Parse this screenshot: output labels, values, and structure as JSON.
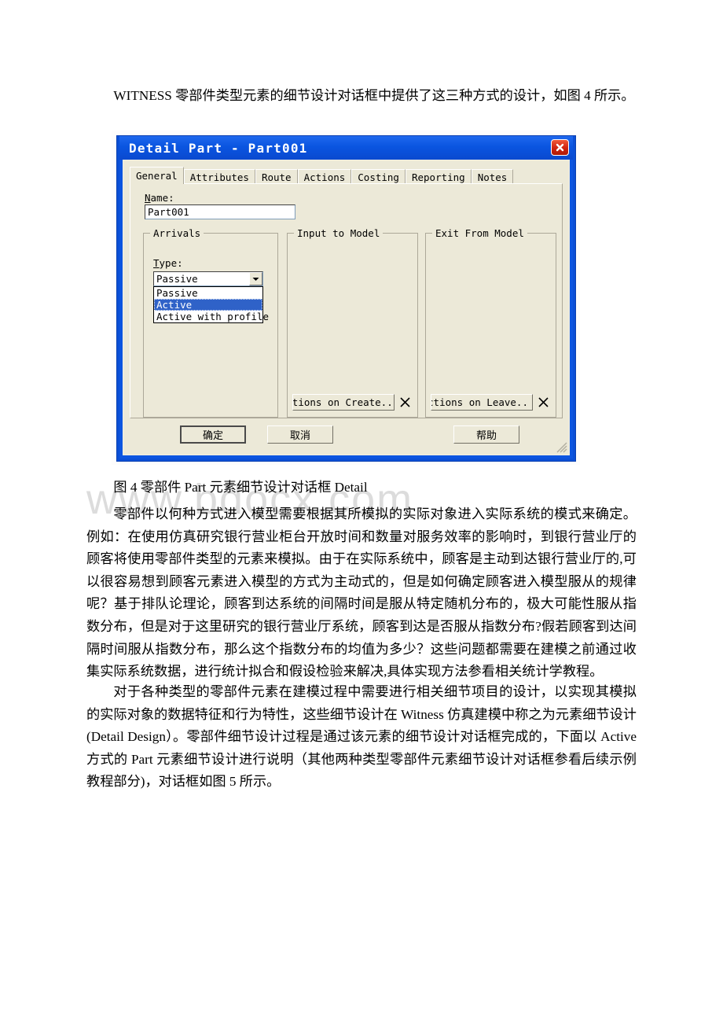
{
  "document": {
    "paragraph_1": "WITNESS 零部件类型元素的细节设计对话框中提供了这三种方式的设计，如图 4 所示。",
    "figure_caption": "图 4 零部件 Part 元素细节设计对话框 Detail",
    "paragraph_2": "零部件以何种方式进入模型需要根据其所模拟的实际对象进入实际系统的模式来确定。例如：在使用仿真研究银行营业柜台开放时间和数量对服务效率的影响时，到银行营业厅的顾客将使用零部件类型的元素来模拟。由于在实际系统中，顾客是主动到达银行营业厅的,可以很容易想到顾客元素进入模型的方式为主动式的，但是如何确定顾客进入模型服从的规律呢？基于排队论理论，顾客到达系统的间隔时间是服从特定随机分布的，极大可能性服从指数分布，但是对于这里研究的银行营业厅系统，顾客到达是否服从指数分布?假若顾客到达间隔时间服从指数分布，那么这个指数分布的均值为多少？这些问题都需要在建模之前通过收集实际系统数据，进行统计拟合和假设检验来解决,具体实现方法参看相关统计学教程。",
    "paragraph_3": "对于各种类型的零部件元素在建模过程中需要进行相关细节项目的设计，以实现其模拟的实际对象的数据特征和行为特性，这些细节设计在 Witness 仿真建模中称之为元素细节设计(Detail Design）。零部件细节设计过程是通过该元素的细节设计对话框完成的，下面以 Active 方式的 Part 元素细节设计进行说明（其他两种类型零部件元素细节设计对话框参看后续示例教程部分)，对话框如图 5 所示。",
    "watermark": "www.bdocx.com"
  },
  "dialog": {
    "title": "Detail Part - Part001",
    "close_icon": "close-icon",
    "tabs": [
      {
        "label": "General",
        "active": true
      },
      {
        "label": "Attributes",
        "active": false
      },
      {
        "label": "Route",
        "active": false
      },
      {
        "label": "Actions",
        "active": false
      },
      {
        "label": "Costing",
        "active": false
      },
      {
        "label": "Reporting",
        "active": false
      },
      {
        "label": "Notes",
        "active": false
      }
    ],
    "name_field": {
      "label_prefix": "N",
      "label_rest": "ame:",
      "value": "Part001"
    },
    "arrivals": {
      "group_title": "Arrivals",
      "type_label_prefix": "T",
      "type_label_rest": "ype:",
      "selected_value": "Passive",
      "options": [
        {
          "label": "Passive",
          "selected": false
        },
        {
          "label": "Active",
          "selected": true
        },
        {
          "label": "Active with profile",
          "selected": false
        }
      ],
      "dropdown_open": true
    },
    "input_to_model": {
      "group_title": "Input to Model",
      "action_button_label": "ctions on Create..",
      "delete_icon": "delete-x-icon"
    },
    "exit_from_model": {
      "group_title": "Exit From Model",
      "action_button_label": "ctions on Leave..",
      "delete_icon": "delete-x-icon"
    },
    "buttons": {
      "ok": "确定",
      "cancel": "取消",
      "help": "帮助"
    },
    "colors": {
      "titlebar": "#0c55e0",
      "face": "#ece9d8",
      "highlight": "#2f62c8",
      "close_button": "#cf2310"
    }
  }
}
